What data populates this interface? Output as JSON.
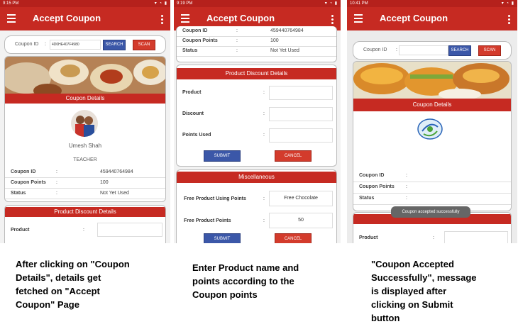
{
  "colors": {
    "primary": "#c62a22",
    "status": "#b5211c",
    "accent_blue": "#3b57a8",
    "button_red": "#d33b2c"
  },
  "screen1": {
    "status_time": "9:15 PM",
    "title": "Accept Coupon",
    "coupon_id_label": "Coupon ID",
    "coupon_id_value": "4D0HE407F4980",
    "search_label": "SEARCH",
    "scan_label": "SCAN",
    "coupon_details_header": "Coupon Details",
    "user_name": "Umesh Shah",
    "user_role": "TEACHER",
    "rows": [
      {
        "key": "Coupon ID",
        "value": "459440764984"
      },
      {
        "key": "Coupon Points",
        "value": "100"
      },
      {
        "key": "Status",
        "value": "Not Yet Used"
      }
    ],
    "product_discount_header": "Product Discount Details",
    "product_label": "Product"
  },
  "screen2": {
    "status_time": "9:19 PM",
    "title": "Accept Coupon",
    "rows": [
      {
        "key": "Coupon ID",
        "value": "459440764984"
      },
      {
        "key": "Coupon Points",
        "value": "100"
      },
      {
        "key": "Status",
        "value": "Not Yet Used"
      }
    ],
    "product_discount_header": "Product Discount Details",
    "product_label": "Product",
    "discount_label": "Discount",
    "points_used_label": "Points Used",
    "submit_label": "SUBMIT",
    "cancel_label": "CANCEL",
    "misc_header": "Miscellaneous",
    "free_product_using_points_label": "Free Product Using Points",
    "free_product_using_points_value": "Free Chocolate",
    "free_product_points_label": "Free Product Points",
    "free_product_points_value": "50"
  },
  "screen3": {
    "status_time": "10:41 PM",
    "title": "Accept Coupon",
    "coupon_id_label": "Coupon ID",
    "search_label": "SEARCH",
    "scan_label": "SCAN",
    "coupon_details_header": "Coupon Details",
    "rows": [
      {
        "key": "Coupon ID",
        "value": ""
      },
      {
        "key": "Coupon Points",
        "value": ""
      },
      {
        "key": "Status",
        "value": ""
      }
    ],
    "toast": "Coupon accepted successfully",
    "product_label": "Product"
  },
  "captions": {
    "c1": "After clicking on \"Coupon Details\", details get fetched on \"Accept Coupon\" Page",
    "c2": "Enter Product name and points according to the Coupon points",
    "c3": "\"Coupon Accepted Successfully\", message is displayed after clicking on Submit button"
  }
}
